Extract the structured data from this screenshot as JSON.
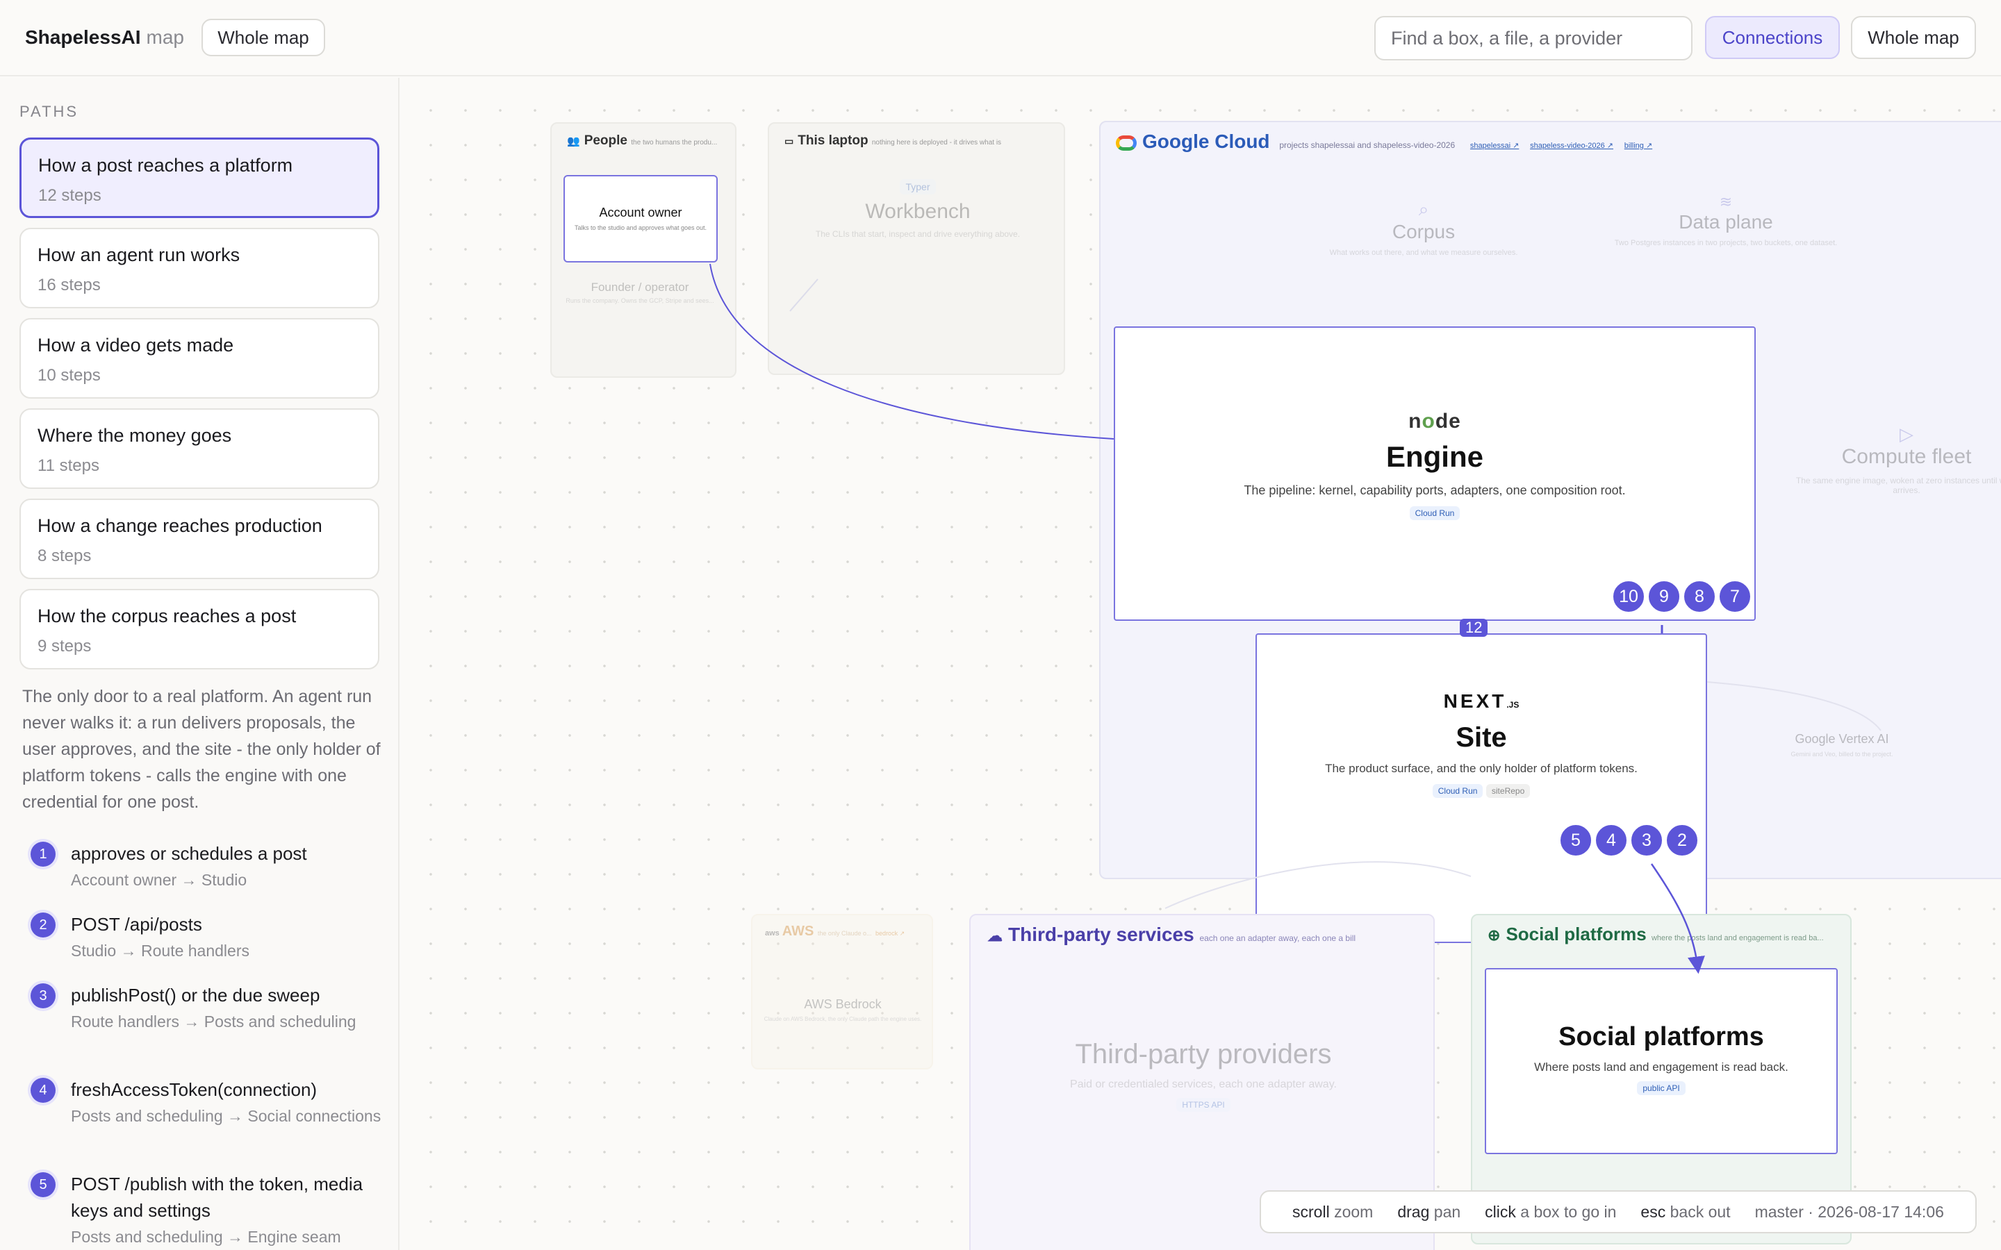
{
  "header": {
    "brand": "ShapelessAI",
    "brand_sub": "map",
    "scope_pill": "Whole map",
    "search_placeholder": "Find a box, a file, a provider",
    "connections_label": "Connections",
    "whole_map_label": "Whole map"
  },
  "sidebar": {
    "section_label": "PATHS",
    "paths": [
      {
        "title": "How a post reaches a platform",
        "steps": "12 steps"
      },
      {
        "title": "How an agent run works",
        "steps": "16 steps"
      },
      {
        "title": "How a video gets made",
        "steps": "10 steps"
      },
      {
        "title": "Where the money goes",
        "steps": "11 steps"
      },
      {
        "title": "How a change reaches production",
        "steps": "8 steps"
      },
      {
        "title": "How the corpus reaches a post",
        "steps": "9 steps"
      }
    ],
    "description": "The only door to a real platform. An agent run never walks it: a run delivers proposals, the user approves, and the site - the only holder of platform tokens - calls the engine with one credential for one post.",
    "steps": [
      {
        "n": "1",
        "action": "approves or schedules a post",
        "route": "Account owner → Studio"
      },
      {
        "n": "2",
        "action": "POST /api/posts",
        "route": "Studio → Route handlers"
      },
      {
        "n": "3",
        "action": "publishPost() or the due sweep",
        "route": "Route handlers → Posts and scheduling"
      },
      {
        "n": "4",
        "action": "freshAccessToken(connection)",
        "route": "Posts and scheduling → Social connections"
      },
      {
        "n": "5",
        "action": "POST /publish with the token, media keys and settings",
        "route": "Posts and scheduling → Engine seam"
      }
    ]
  },
  "map": {
    "people": {
      "title": "People",
      "note": "the two humans the produ...",
      "account_owner": "Account owner",
      "account_owner_desc": "Talks to the studio and approves what goes out.",
      "founder": "Founder / operator",
      "founder_desc": "Runs the company. Owns the GCP, Stripe and sees..."
    },
    "laptop": {
      "title": "This laptop",
      "note": "nothing here is deployed - it drives what is",
      "workbench": "Workbench",
      "workbench_tag": "Typer",
      "workbench_desc": "The CLIs that start, inspect and drive everything above."
    },
    "gcloud": {
      "title": "Google Cloud",
      "note": "projects shapelessai and shapeless-video-2026",
      "links": [
        "shapelessai ↗",
        "shapeless-video-2026 ↗",
        "billing ↗"
      ],
      "corpus": "Corpus",
      "corpus_desc": "What works out there, and what we measure ourselves.",
      "data_plane": "Data plane",
      "data_plane_desc": "Two Postgres instances in two projects, two buckets, one dataset.",
      "compute": "Compute fleet",
      "compute_desc": "The same engine image, woken at zero instances until work arrives.",
      "vertex": "Google Vertex AI",
      "vertex_desc": "Gemini and Veo, billed to the project."
    },
    "engine": {
      "title": "Engine",
      "desc": "The pipeline: kernel, capability ports, adapters, one composition root.",
      "tag": "Cloud Run",
      "badges": [
        "10",
        "9",
        "8",
        "7"
      ],
      "edge_label": "12"
    },
    "site": {
      "title": "Site",
      "desc": "The product surface, and the only holder of platform tokens.",
      "tags": [
        "Cloud Run",
        "siteRepo"
      ],
      "badges": [
        "5",
        "4",
        "3",
        "2"
      ]
    },
    "aws": {
      "title": "AWS",
      "note": "the only Claude o...",
      "link": "bedrock ↗",
      "bedrock": "AWS Bedrock",
      "bedrock_desc": "Claude on AWS Bedrock, the only Claude path the engine uses."
    },
    "third_party": {
      "title": "Third-party services",
      "note": "each one an adapter away, each one a bill",
      "providers": "Third-party providers",
      "providers_desc": "Paid or credentialed services, each one adapter away.",
      "providers_tag": "HTTPS API"
    },
    "social": {
      "title": "Social platforms",
      "note": "where the posts land and engagement is read ba...",
      "card_title": "Social platforms",
      "card_desc": "Where posts land and engagement is read back.",
      "card_tag": "public API"
    }
  },
  "legend": {
    "items": [
      {
        "key": "scroll",
        "val": "zoom"
      },
      {
        "key": "drag",
        "val": "pan"
      },
      {
        "key": "click",
        "val": "a box to go in"
      },
      {
        "key": "esc",
        "val": "back out"
      }
    ],
    "build": "master · 2026-08-17 14:06"
  }
}
